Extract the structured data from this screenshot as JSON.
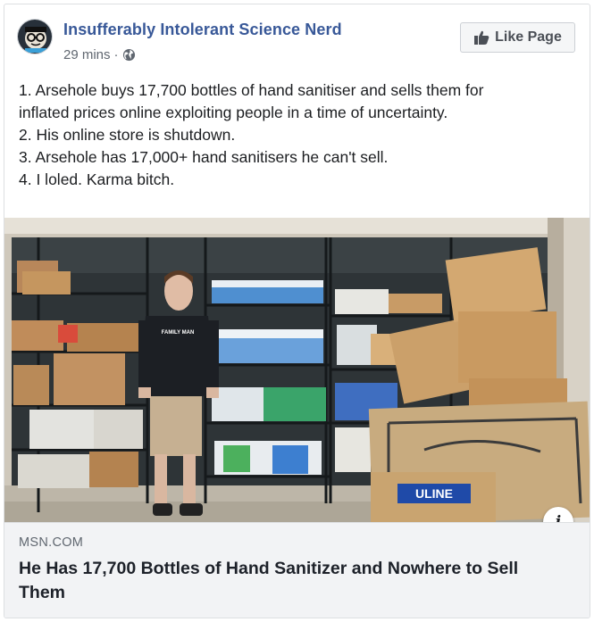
{
  "post": {
    "page_name": "Insufferably Intolerant Science Nerd",
    "timestamp": "29 mins",
    "meta_separator": "·",
    "privacy_icon": "globe-icon",
    "avatar_icon": "nerd-face-logo",
    "like_button": {
      "icon": "thumbs-up-icon",
      "label": "Like Page"
    },
    "text_lines": [
      "1. Arsehole buys 17,700 bottles of hand sanitiser and sells them for",
      "inflated prices online exploiting people in a time of uncertainty.",
      "2. His online store is shutdown.",
      "3. Arsehole has 17,000+ hand sanitisers he can't sell.",
      "4. I loled. Karma bitch."
    ]
  },
  "photo": {
    "shirt_text": "FAMILY MAN",
    "box_brand": "ULINE",
    "info_icon": "info-icon"
  },
  "link": {
    "domain": "MSN.COM",
    "title": "He Has 17,700 Bottles of Hand Sanitizer and Nowhere to Sell Them"
  },
  "colors": {
    "page_name": "#385898",
    "meta": "#606770",
    "link_bg": "#f2f3f5",
    "uline_blue": "#1f4aa8"
  }
}
